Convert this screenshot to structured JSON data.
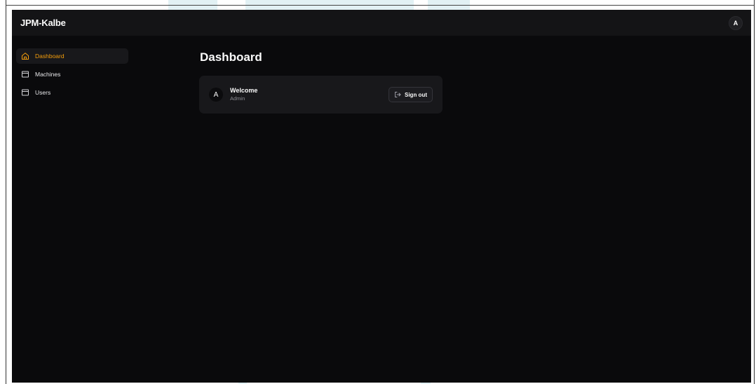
{
  "header": {
    "brand": "JPM-Kalbe",
    "avatar_initial": "A"
  },
  "sidebar": {
    "items": [
      {
        "label": "Dashboard",
        "icon": "home-icon",
        "active": true
      },
      {
        "label": "Machines",
        "icon": "box-icon",
        "active": false
      },
      {
        "label": "Users",
        "icon": "box-icon",
        "active": false
      }
    ]
  },
  "main": {
    "title": "Dashboard",
    "welcome_card": {
      "avatar_initial": "A",
      "title": "Welcome",
      "subtitle": "Admin",
      "signout_label": "Sign out",
      "signout_icon": "log-out-icon"
    }
  },
  "colors": {
    "accent": "#f59e0b",
    "background": "#0a0a0c",
    "surface": "#18181b"
  }
}
